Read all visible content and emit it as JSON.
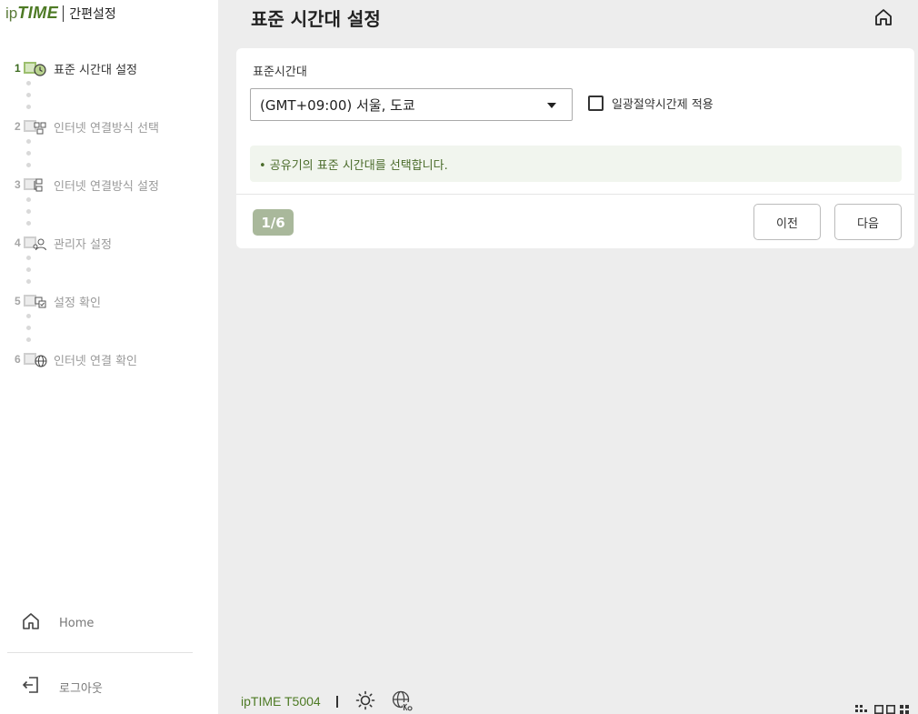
{
  "brand": {
    "prefix": "ip",
    "name": "TIME",
    "subtitle": "간편설정"
  },
  "steps": [
    {
      "num": "1",
      "label": "표준 시간대 설정",
      "icon": "clock-icon",
      "active": true
    },
    {
      "num": "2",
      "label": "인터넷 연결방식 선택",
      "icon": "network-icon",
      "active": false
    },
    {
      "num": "3",
      "label": "인터넷 연결방식 설정",
      "icon": "network-settings-icon",
      "active": false
    },
    {
      "num": "4",
      "label": "관리자 설정",
      "icon": "admin-user-icon",
      "active": false
    },
    {
      "num": "5",
      "label": "설정 확인",
      "icon": "check-settings-icon",
      "active": false
    },
    {
      "num": "6",
      "label": "인터넷 연결 확인",
      "icon": "globe-icon",
      "active": false
    }
  ],
  "sidebar_links": {
    "home": "Home",
    "logout": "로그아웃"
  },
  "page": {
    "title": "표준 시간대 설정"
  },
  "form": {
    "timezone_label": "표준시간대",
    "timezone_value": "(GMT+09:00) 서울, 도쿄",
    "dst_label": "일광절약시간제 적용",
    "dst_checked": false,
    "notice": "• 공유기의 표준 시간대를 선택합니다."
  },
  "progress": {
    "badge": "1/6",
    "current": 1,
    "total": 6
  },
  "buttons": {
    "prev": "이전",
    "next": "다음"
  },
  "footer": {
    "model": "ipTIME T5004"
  },
  "colors": {
    "accent": "#4d7a24",
    "badge_bg": "#a9b89b",
    "notice_bg": "#f1f5ee",
    "notice_text": "#4a6b2a"
  }
}
